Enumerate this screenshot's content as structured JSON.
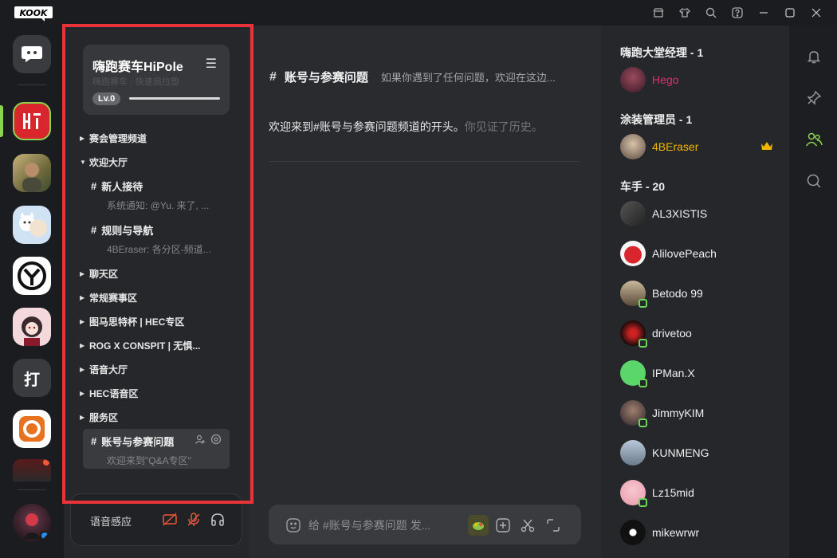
{
  "app": {
    "logo_text": "KOOK"
  },
  "server": {
    "name": "嗨跑赛车HiPole",
    "ghost": "嗨跑赛车 · 快速扇拉塑",
    "level": "Lv.0"
  },
  "categories": [
    {
      "label": "赛会管理频道",
      "expanded": false
    },
    {
      "label": "欢迎大厅",
      "expanded": true
    },
    {
      "label": "聊天区",
      "expanded": false
    },
    {
      "label": "常规赛事区",
      "expanded": false
    },
    {
      "label": "图马思特杯 | HEC专区",
      "expanded": false
    },
    {
      "label": "ROG X CONSPIT | 无惧...",
      "expanded": false
    },
    {
      "label": "语音大厅",
      "expanded": false
    },
    {
      "label": "HEC语音区",
      "expanded": false
    },
    {
      "label": "服务区",
      "expanded": false
    }
  ],
  "channels": [
    {
      "name": "新人接待",
      "preview": "系统通知: @Yu. 来了, ..."
    },
    {
      "name": "规则与导航",
      "preview": "4BEraser: 各分区-频道..."
    },
    {
      "name": "账号与参赛问题",
      "preview": "欢迎来到\"Q&A专区\""
    }
  ],
  "voice": {
    "label": "语音感应"
  },
  "rail": {
    "text_server": "打"
  },
  "chat": {
    "title": "账号与参赛问题",
    "topic": "如果你遇到了任何问题，欢迎在这边...",
    "welcome_main": "欢迎来到#账号与参赛问题频道的开头。",
    "welcome_gray": "你见证了历史。",
    "placeholder": "给 #账号与参赛问题 发..."
  },
  "members": {
    "roles": [
      {
        "label": "嗨跑大堂经理 - 1"
      },
      {
        "label": "涂装管理员 - 1"
      },
      {
        "label": "车手 - 20"
      }
    ],
    "list": [
      {
        "name": "Hego",
        "color": "#e0306a"
      },
      {
        "name": "4BEraser",
        "color": "#f2b600"
      },
      {
        "name": "AL3XISTIS",
        "color": "#f0f0f0"
      },
      {
        "name": "AlilovePeach",
        "color": "#f0f0f0"
      },
      {
        "name": "Betodo 99",
        "color": "#f0f0f0"
      },
      {
        "name": "drivetoo",
        "color": "#f0f0f0"
      },
      {
        "name": "IPMan.X",
        "color": "#f0f0f0"
      },
      {
        "name": "JimmyKIM",
        "color": "#f0f0f0"
      },
      {
        "name": "KUNMENG",
        "color": "#f0f0f0"
      },
      {
        "name": "Lz15mid",
        "color": "#f0f0f0"
      },
      {
        "name": "mikewrwr",
        "color": "#f0f0f0"
      }
    ]
  },
  "colors": {
    "accent": "#8bd450",
    "highlight_box": "#e8333a",
    "brand_red": "#d8262c"
  }
}
